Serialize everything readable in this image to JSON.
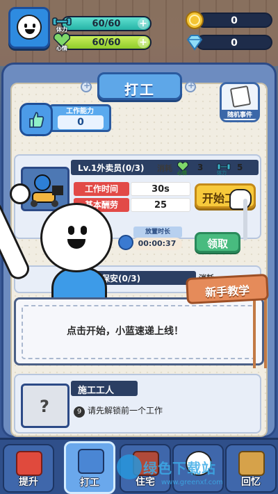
{
  "hud": {
    "stamina": {
      "label": "体力",
      "value": "60/60",
      "fill_fraction": 1.0
    },
    "mood": {
      "label": "心情",
      "value": "60/60",
      "fill_fraction": 1.0
    },
    "coins": "0",
    "gems": "0"
  },
  "panel": {
    "title": "打工",
    "work_ability": {
      "label": "工作能力",
      "value": "0"
    },
    "random_event_label": "随机事件"
  },
  "jobs": [
    {
      "title": "Lv.1外卖员(0/3)",
      "cost_label": "消耗",
      "cost_mood_label": "心情",
      "cost_mood": "3",
      "cost_stamina_label": "体力",
      "cost_stamina": "5",
      "work_time_label": "工作时间",
      "work_time": "30s",
      "base_pay_label": "基本酬劳",
      "base_pay": "25",
      "start_label": "开始工",
      "idle_label": "放置时长",
      "idle_time": "00:00:37",
      "claim_label": "领取"
    },
    {
      "title": "保安(0/3)",
      "cost_label": "消耗"
    },
    {
      "title": "施工工人",
      "condition_index": "9",
      "condition_text": "请先解锁前一个工作"
    }
  ],
  "tutorial": {
    "tag": "新手教学",
    "message": "点击开始，小蓝速递上线！"
  },
  "nav": [
    {
      "label": "提升",
      "icon": "book-icon",
      "active": false
    },
    {
      "label": "打工",
      "icon": "work-icon",
      "active": true
    },
    {
      "label": "住宅",
      "icon": "house-icon",
      "active": false
    },
    {
      "label": "",
      "icon": "chat-icon",
      "active": false
    },
    {
      "label": "回忆",
      "icon": "memory-icon",
      "active": false
    }
  ],
  "watermark": {
    "text": "绿色下载站",
    "url": "www.greenxf.com"
  }
}
